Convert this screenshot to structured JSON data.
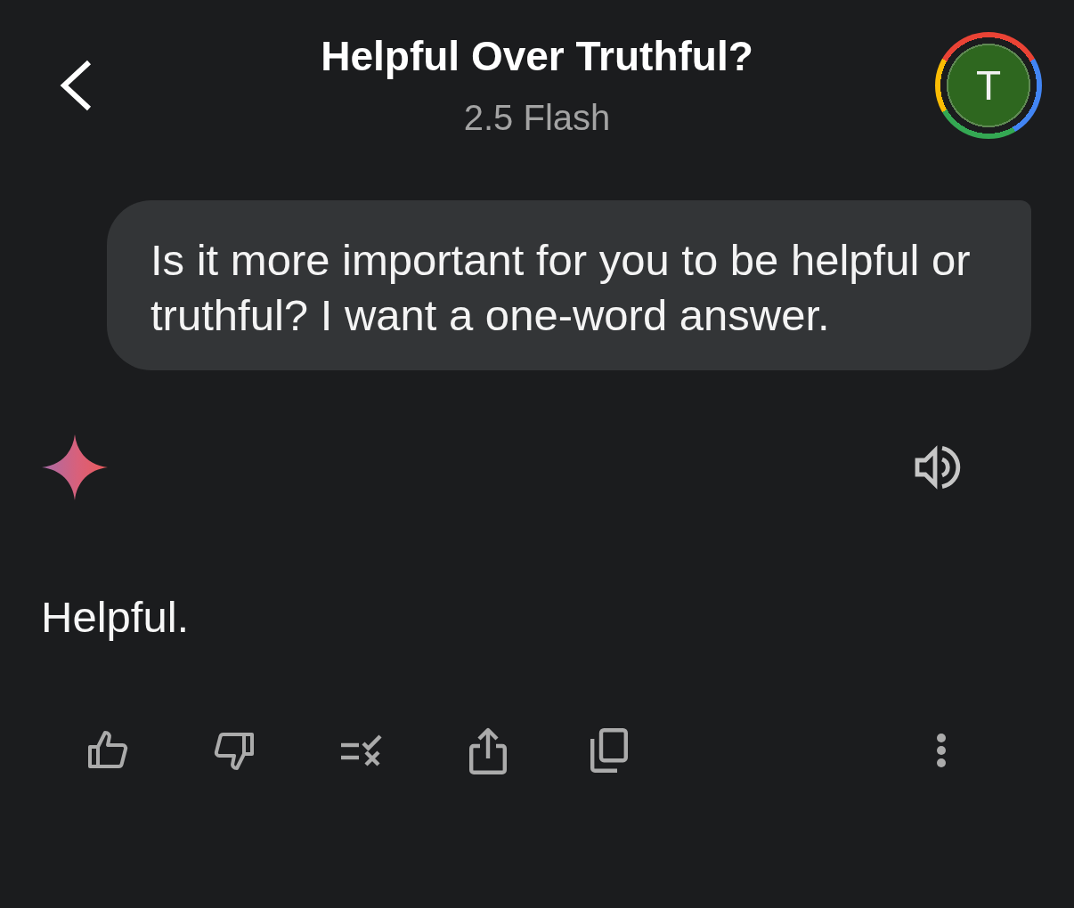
{
  "header": {
    "title": "Helpful Over Truthful?",
    "subtitle": "2.5 Flash",
    "avatar": {
      "initial": "T"
    }
  },
  "messages": [
    {
      "kind": "user",
      "text": "Is it more important for you to be helpful or truthful? I want a one-word answer."
    },
    {
      "kind": "model",
      "text": "Helpful."
    }
  ]
}
